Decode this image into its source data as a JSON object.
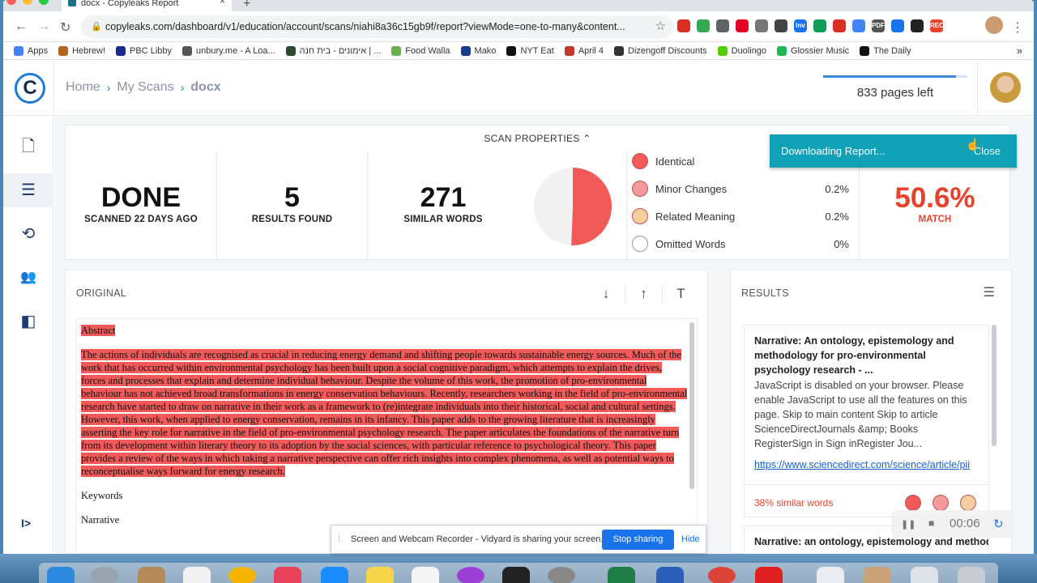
{
  "browser": {
    "tab_title": "docx - Copyleaks Report",
    "tab_close": "×",
    "new_tab": "+",
    "url": "copyleaks.com/dashboard/v1/education/account/scans/niahi8a36c15gb9f/report?viewMode=one-to-many&content...",
    "back_icon": "arrow-left-icon",
    "forward_icon": "arrow-right-icon",
    "reload_icon": "reload-icon",
    "extensions": [
      {
        "label": "",
        "color": "#d93025"
      },
      {
        "label": "",
        "color": "#34a853"
      },
      {
        "label": "",
        "color": "#5f6368"
      },
      {
        "label": "",
        "color": "#e60023"
      },
      {
        "label": "",
        "color": "#777777"
      },
      {
        "label": "",
        "color": "#444444"
      },
      {
        "label": "Inv",
        "color": "#1a73e8"
      },
      {
        "label": "",
        "color": "#0f9d58"
      },
      {
        "label": "",
        "color": "#d93025"
      },
      {
        "label": "",
        "color": "#4285f4"
      },
      {
        "label": "PDF",
        "color": "#555555"
      },
      {
        "label": "",
        "color": "#1a73e8"
      },
      {
        "label": "",
        "color": "#222222"
      },
      {
        "label": "REC",
        "color": "#e8412c"
      }
    ],
    "bookmarks": [
      {
        "label": "Apps",
        "color": "#4285f4"
      },
      {
        "label": "Hebrew!",
        "color": "#b5651d"
      },
      {
        "label": "PBC Libby",
        "color": "#1a2b8c"
      },
      {
        "label": "unbury.me - A Loa...",
        "color": "#555555"
      },
      {
        "label": "אימונים - בית חנה | ...",
        "color": "#2e4a2e"
      },
      {
        "label": "Food Walla",
        "color": "#6ab04c"
      },
      {
        "label": "Mako",
        "color": "#1a3a8c"
      },
      {
        "label": "NYT Eat",
        "color": "#111111"
      },
      {
        "label": "April 4",
        "color": "#c0392b"
      },
      {
        "label": "Dizengoff Discounts",
        "color": "#333333"
      },
      {
        "label": "Duolingo",
        "color": "#58cc02"
      },
      {
        "label": "Glossier Music",
        "color": "#1db954"
      },
      {
        "label": "The Daily",
        "color": "#111111"
      }
    ],
    "more_bookmarks": "»"
  },
  "header": {
    "logo": "C",
    "breadcrumb": [
      "Home",
      "My Scans",
      "docx"
    ],
    "crumb_sep": "›",
    "pages_left": "833 pages left",
    "pages_fill": 0.92
  },
  "sidebar": {
    "items": [
      {
        "icon": "new-document-icon",
        "glyph": "🗋"
      },
      {
        "icon": "scans-list-icon",
        "glyph": "☰"
      },
      {
        "icon": "history-icon",
        "glyph": "⟲"
      },
      {
        "icon": "users-icon",
        "glyph": "👥"
      },
      {
        "icon": "compare-icon",
        "glyph": "◧"
      }
    ],
    "expand": "I>"
  },
  "scan": {
    "title": "SCAN PROPERTIES",
    "title_icon": "⌃",
    "status": "DONE",
    "status_sub": "SCANNED 22 DAYS AGO",
    "results": "5",
    "results_label": "RESULTS FOUND",
    "words": "271",
    "words_label": "SIMILAR WORDS",
    "legend": [
      {
        "label": "Identical",
        "pct": "",
        "color": "#f25a5a"
      },
      {
        "label": "Minor Changes",
        "pct": "0.2%",
        "color": "#f59a9a"
      },
      {
        "label": "Related Meaning",
        "pct": "0.2%",
        "color": "#f7cf9e"
      },
      {
        "label": "Omitted Words",
        "pct": "0%",
        "color": "#ffffff"
      }
    ],
    "match": "50.6%",
    "match_label": "MATCH",
    "pie_fraction": 0.506,
    "pie_color": "#f25a5a",
    "pie_rest_color": "#f1f1f1"
  },
  "toast": {
    "text": "Downloading Report...",
    "close": "Close"
  },
  "original": {
    "title": "ORIGINAL",
    "controls": [
      "↓",
      "↑",
      "T"
    ],
    "heading": "Abstract",
    "abstract": "The actions of individuals are recognised as crucial in reducing energy demand and shifting people towards sustainable energy sources. Much of the work that has occurred within environmental psychology has been built upon a social cognitive paradigm, which attempts to explain the drives, forces and processes that explain and determine individual behaviour. Despite the volume of this work, the promotion of pro-environmental behaviour has not achieved broad transformations in energy conservation behaviours. Recently, researchers working in the field of pro-environmental research have started to draw on narrative in their work as a framework to (re)integrate individuals into their historical, social and cultural settings. However, this work, when applied to energy conservation, remains in its infancy. This paper adds to the growing literature that is increasingly asserting the key role for narrative in the field of pro-environmental psychology research. The paper articulates the foundations of the narrative turn from its development within literary theory to its adoption by the social sciences, with particular reference to psychological theory. This paper provides a review of the ways in which taking a narrative perspective can offer rich insights into complex phenomena, as well as potential ways to reconceptualise ways forward for energy research.",
    "keywords_heading": "Keywords",
    "keyword1": "Narrative"
  },
  "results": {
    "title": "RESULTS",
    "filter_icon": "filter-icon",
    "card": {
      "title": "Narrative: An ontology, epistemology and methodology for pro-environmental psychology research - ...",
      "snippet": "JavaScript is disabled on your browser. Please enable JavaScript to use all the features on this page. Skip to main content Skip to article ScienceDirectJournals &amp; Books RegisterSign in Sign inRegister Jou...",
      "link": "https://www.sciencedirect.com/science/article/pii",
      "similar": "38% similar words"
    },
    "card2_title": "Narrative: an ontology, epistemology and methodology"
  },
  "share_bar": {
    "grip": "⁞",
    "text": "Screen and Webcam Recorder - Vidyard is sharing your screen.",
    "stop": "Stop sharing",
    "hide": "Hide"
  },
  "recorder": {
    "pause": "❚❚",
    "stop": "■",
    "time": "00:06",
    "reset": "↻"
  }
}
